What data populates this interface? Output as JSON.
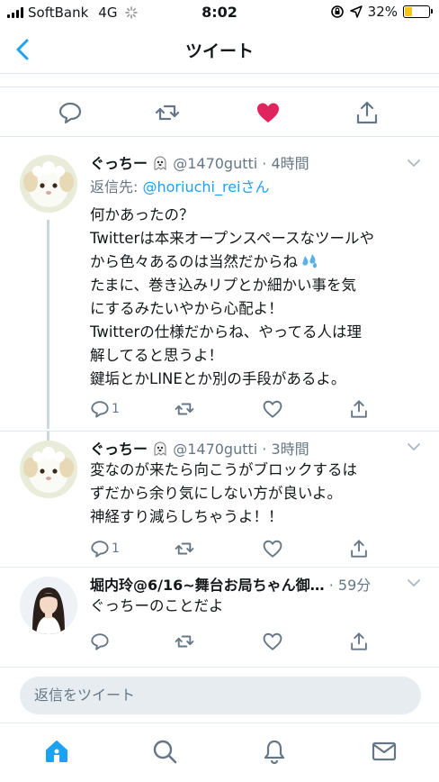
{
  "status_bar": {
    "carrier": "SoftBank",
    "network": "4G",
    "time": "8:02",
    "battery": "32%",
    "battery_level": 0.32
  },
  "nav": {
    "title": "ツイート",
    "back_icon": "chevron-left-icon"
  },
  "main_actions": {
    "icons": [
      "reply-icon",
      "retweet-icon",
      "like-icon",
      "share-icon"
    ],
    "liked": true,
    "like_color": "#e0245e"
  },
  "replies": [
    {
      "name": "ぐっちー",
      "handle_time": "@1470gutti · 4時間",
      "reply_to_prefix": "返信先: ",
      "reply_to_handle": "@horiuchi_rei",
      "reply_to_suffix": "さん",
      "lines": [
        "何かあったの？",
        "Twitterは本来オープンスペースなツールや",
        "から色々あるのは当然だからね",
        "たまに、巻き込みリプとか細かい事を気",
        "にするみたいやから心配よ！",
        "Twitterの仕様だからね、やってる人は理",
        "解してると思うよ！",
        "鍵垢とかLINEとか別の手段があるよ。"
      ],
      "reply_count": "1"
    },
    {
      "name": "ぐっちー",
      "handle_time": "@1470gutti · 3時間",
      "lines": [
        "変なのが来たら向こうがブロックするは",
        "ずだから余り気にしない方が良いよ。",
        "神経すり減らしちゃうよ！！"
      ],
      "reply_count": "1"
    },
    {
      "name": "堀内玲@6/16~舞台お局ちゃん御…",
      "handle_time": " · 59分",
      "lines": [
        "ぐっちーのことだよ"
      ],
      "reply_count": ""
    }
  ],
  "composer": {
    "placeholder": "返信をツイート"
  },
  "tab_bar": {
    "icons": [
      "home-icon",
      "search-icon",
      "notifications-icon",
      "messages-icon"
    ],
    "accent": "#1da1f2"
  }
}
